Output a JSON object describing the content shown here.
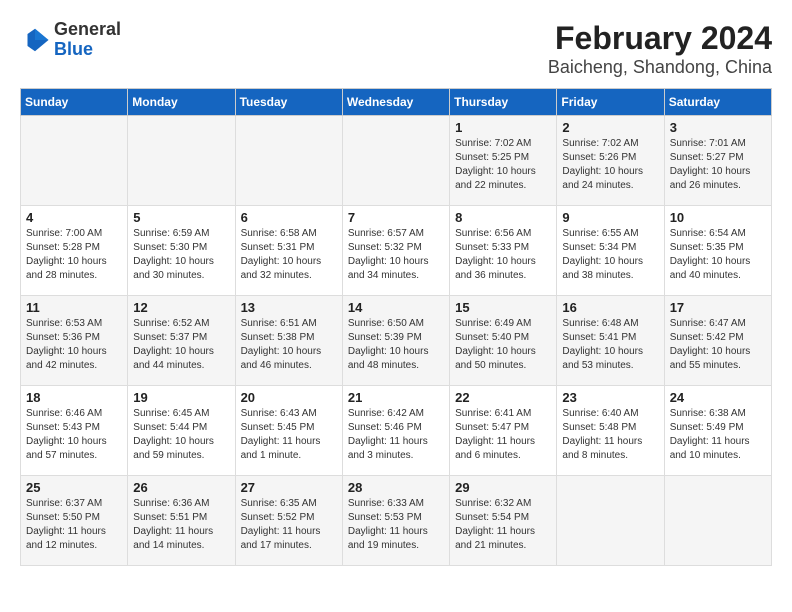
{
  "logo": {
    "general": "General",
    "blue": "Blue"
  },
  "title": "February 2024",
  "subtitle": "Baicheng, Shandong, China",
  "days": [
    "Sunday",
    "Monday",
    "Tuesday",
    "Wednesday",
    "Thursday",
    "Friday",
    "Saturday"
  ],
  "weeks": [
    [
      {
        "date": "",
        "info": ""
      },
      {
        "date": "",
        "info": ""
      },
      {
        "date": "",
        "info": ""
      },
      {
        "date": "",
        "info": ""
      },
      {
        "date": "1",
        "info": "Sunrise: 7:02 AM\nSunset: 5:25 PM\nDaylight: 10 hours\nand 22 minutes."
      },
      {
        "date": "2",
        "info": "Sunrise: 7:02 AM\nSunset: 5:26 PM\nDaylight: 10 hours\nand 24 minutes."
      },
      {
        "date": "3",
        "info": "Sunrise: 7:01 AM\nSunset: 5:27 PM\nDaylight: 10 hours\nand 26 minutes."
      }
    ],
    [
      {
        "date": "4",
        "info": "Sunrise: 7:00 AM\nSunset: 5:28 PM\nDaylight: 10 hours\nand 28 minutes."
      },
      {
        "date": "5",
        "info": "Sunrise: 6:59 AM\nSunset: 5:30 PM\nDaylight: 10 hours\nand 30 minutes."
      },
      {
        "date": "6",
        "info": "Sunrise: 6:58 AM\nSunset: 5:31 PM\nDaylight: 10 hours\nand 32 minutes."
      },
      {
        "date": "7",
        "info": "Sunrise: 6:57 AM\nSunset: 5:32 PM\nDaylight: 10 hours\nand 34 minutes."
      },
      {
        "date": "8",
        "info": "Sunrise: 6:56 AM\nSunset: 5:33 PM\nDaylight: 10 hours\nand 36 minutes."
      },
      {
        "date": "9",
        "info": "Sunrise: 6:55 AM\nSunset: 5:34 PM\nDaylight: 10 hours\nand 38 minutes."
      },
      {
        "date": "10",
        "info": "Sunrise: 6:54 AM\nSunset: 5:35 PM\nDaylight: 10 hours\nand 40 minutes."
      }
    ],
    [
      {
        "date": "11",
        "info": "Sunrise: 6:53 AM\nSunset: 5:36 PM\nDaylight: 10 hours\nand 42 minutes."
      },
      {
        "date": "12",
        "info": "Sunrise: 6:52 AM\nSunset: 5:37 PM\nDaylight: 10 hours\nand 44 minutes."
      },
      {
        "date": "13",
        "info": "Sunrise: 6:51 AM\nSunset: 5:38 PM\nDaylight: 10 hours\nand 46 minutes."
      },
      {
        "date": "14",
        "info": "Sunrise: 6:50 AM\nSunset: 5:39 PM\nDaylight: 10 hours\nand 48 minutes."
      },
      {
        "date": "15",
        "info": "Sunrise: 6:49 AM\nSunset: 5:40 PM\nDaylight: 10 hours\nand 50 minutes."
      },
      {
        "date": "16",
        "info": "Sunrise: 6:48 AM\nSunset: 5:41 PM\nDaylight: 10 hours\nand 53 minutes."
      },
      {
        "date": "17",
        "info": "Sunrise: 6:47 AM\nSunset: 5:42 PM\nDaylight: 10 hours\nand 55 minutes."
      }
    ],
    [
      {
        "date": "18",
        "info": "Sunrise: 6:46 AM\nSunset: 5:43 PM\nDaylight: 10 hours\nand 57 minutes."
      },
      {
        "date": "19",
        "info": "Sunrise: 6:45 AM\nSunset: 5:44 PM\nDaylight: 10 hours\nand 59 minutes."
      },
      {
        "date": "20",
        "info": "Sunrise: 6:43 AM\nSunset: 5:45 PM\nDaylight: 11 hours\nand 1 minute."
      },
      {
        "date": "21",
        "info": "Sunrise: 6:42 AM\nSunset: 5:46 PM\nDaylight: 11 hours\nand 3 minutes."
      },
      {
        "date": "22",
        "info": "Sunrise: 6:41 AM\nSunset: 5:47 PM\nDaylight: 11 hours\nand 6 minutes."
      },
      {
        "date": "23",
        "info": "Sunrise: 6:40 AM\nSunset: 5:48 PM\nDaylight: 11 hours\nand 8 minutes."
      },
      {
        "date": "24",
        "info": "Sunrise: 6:38 AM\nSunset: 5:49 PM\nDaylight: 11 hours\nand 10 minutes."
      }
    ],
    [
      {
        "date": "25",
        "info": "Sunrise: 6:37 AM\nSunset: 5:50 PM\nDaylight: 11 hours\nand 12 minutes."
      },
      {
        "date": "26",
        "info": "Sunrise: 6:36 AM\nSunset: 5:51 PM\nDaylight: 11 hours\nand 14 minutes."
      },
      {
        "date": "27",
        "info": "Sunrise: 6:35 AM\nSunset: 5:52 PM\nDaylight: 11 hours\nand 17 minutes."
      },
      {
        "date": "28",
        "info": "Sunrise: 6:33 AM\nSunset: 5:53 PM\nDaylight: 11 hours\nand 19 minutes."
      },
      {
        "date": "29",
        "info": "Sunrise: 6:32 AM\nSunset: 5:54 PM\nDaylight: 11 hours\nand 21 minutes."
      },
      {
        "date": "",
        "info": ""
      },
      {
        "date": "",
        "info": ""
      }
    ]
  ]
}
